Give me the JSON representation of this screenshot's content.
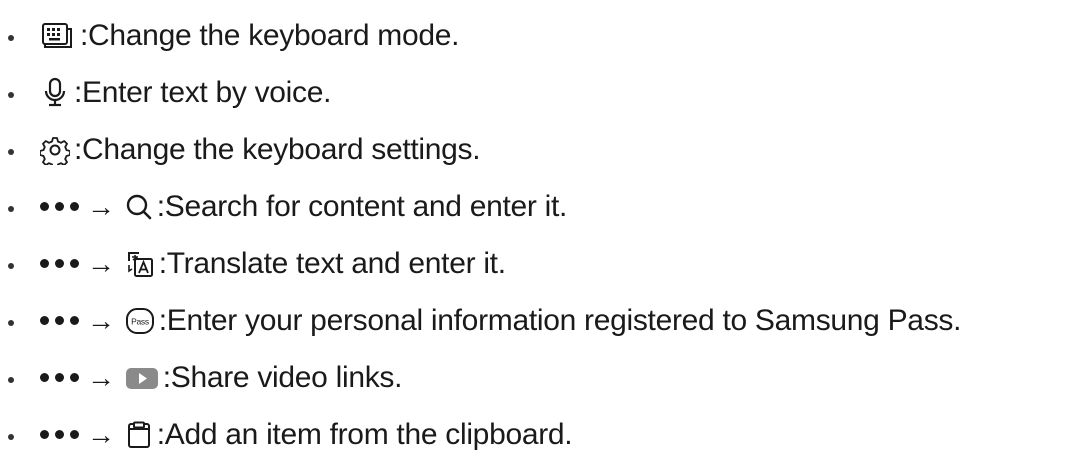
{
  "items": [
    {
      "icon": "keyboard-mode-icon",
      "menu": false,
      "separator": ": ",
      "text": "Change the keyboard mode."
    },
    {
      "icon": "microphone-icon",
      "menu": false,
      "separator": ": ",
      "text": "Enter text by voice."
    },
    {
      "icon": "settings-gear-icon",
      "menu": false,
      "separator": ": ",
      "text": "Change the keyboard settings."
    },
    {
      "icon": "search-icon",
      "menu": true,
      "arrow": "→",
      "separator": " : ",
      "text": "Search for content and enter it."
    },
    {
      "icon": "translate-icon",
      "menu": true,
      "arrow": "→",
      "separator": ": ",
      "text": "Translate text and enter it."
    },
    {
      "icon": "samsung-pass-icon",
      "menu": true,
      "arrow": "→",
      "separator": " : ",
      "text": "Enter your personal information registered to Samsung Pass.",
      "pass_label": "Pass"
    },
    {
      "icon": "video-play-icon",
      "menu": true,
      "arrow": "→",
      "separator": " : ",
      "text": "Share video links."
    },
    {
      "icon": "clipboard-icon",
      "menu": true,
      "arrow": "→",
      "separator": " : ",
      "text": "Add an item from the clipboard."
    }
  ]
}
